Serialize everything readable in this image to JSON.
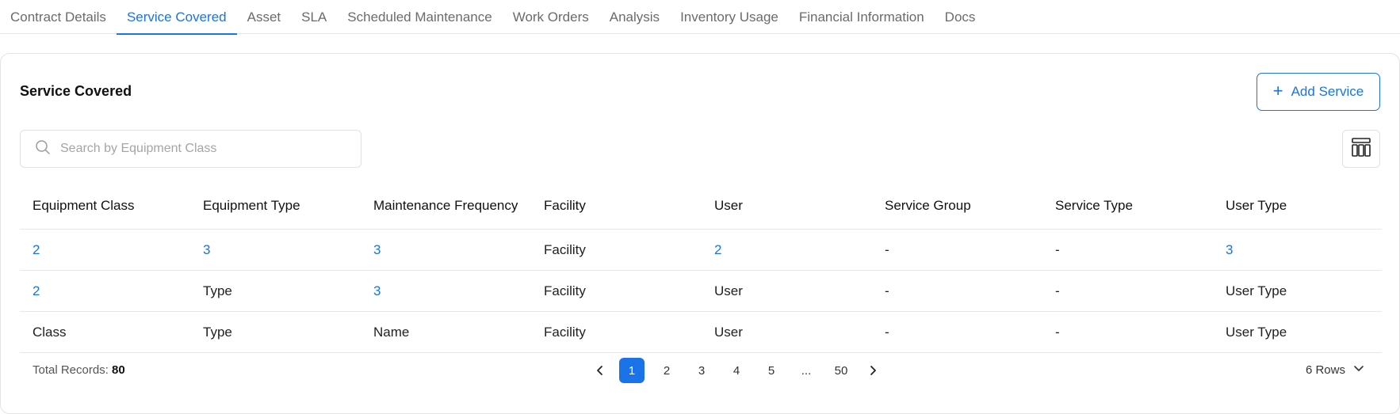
{
  "tabs": [
    {
      "label": "Contract Details",
      "active": false
    },
    {
      "label": "Service Covered",
      "active": true
    },
    {
      "label": "Asset",
      "active": false
    },
    {
      "label": "SLA",
      "active": false
    },
    {
      "label": "Scheduled Maintenance",
      "active": false
    },
    {
      "label": "Work Orders",
      "active": false
    },
    {
      "label": "Analysis",
      "active": false
    },
    {
      "label": "Inventory Usage",
      "active": false
    },
    {
      "label": "Financial Information",
      "active": false
    },
    {
      "label": "Docs",
      "active": false
    }
  ],
  "card": {
    "title": "Service Covered",
    "add_button": {
      "icon": "plus-icon",
      "label": "Add Service"
    },
    "search": {
      "icon": "search-icon",
      "placeholder": "Search by Equipment Class",
      "value": ""
    },
    "columns_button_icon": "columns-icon"
  },
  "table": {
    "headers": [
      "Equipment Class",
      "Equipment Type",
      "Maintenance Frequency",
      "Facility",
      "User",
      "Service Group",
      "Service Type",
      "User Type"
    ],
    "rows": [
      {
        "cells": [
          "2",
          "3",
          "3",
          "Facility",
          "2",
          "-",
          "-",
          "3"
        ],
        "links": [
          true,
          true,
          true,
          false,
          true,
          false,
          false,
          true
        ]
      },
      {
        "cells": [
          "2",
          "Type",
          "3",
          "Facility",
          "User",
          "-",
          "-",
          "User Type"
        ],
        "links": [
          true,
          false,
          true,
          false,
          false,
          false,
          false,
          false
        ]
      },
      {
        "cells": [
          "Class",
          "Type",
          "Name",
          "Facility",
          "User",
          "-",
          "-",
          "User Type"
        ],
        "links": [
          false,
          false,
          false,
          false,
          false,
          false,
          false,
          false
        ]
      }
    ]
  },
  "footer": {
    "total_label": "Total Records:",
    "total_value": "80",
    "pagination": {
      "prev_icon": "chevron-left-icon",
      "next_icon": "chevron-right-icon",
      "pages": [
        "1",
        "2",
        "3",
        "4",
        "5",
        "...",
        "50"
      ],
      "current": "1"
    },
    "rows_label": "6 Rows",
    "rows_icon": "chevron-down-icon"
  },
  "colors": {
    "accent": "#1a73e8",
    "border": "#e3e3e3",
    "muted": "#6b6b6b"
  }
}
